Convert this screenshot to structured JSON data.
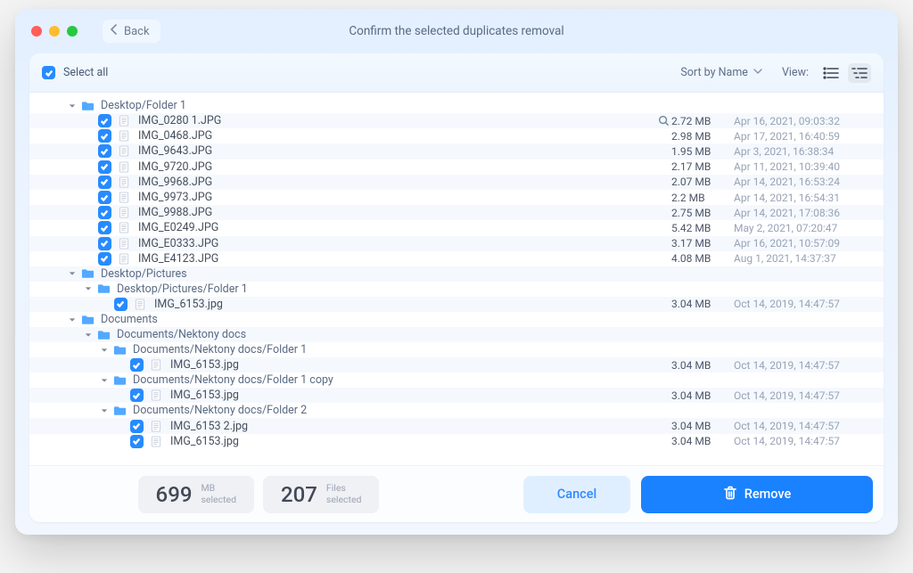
{
  "back": "Back",
  "title": "Confirm the selected duplicates removal",
  "select_all": "Select all",
  "sort_label": "Sort by Name",
  "view_label": "View:",
  "tree": [
    {
      "type": "folder",
      "depth": 0,
      "name": "Desktop/Folder 1"
    },
    {
      "type": "file",
      "depth": 1,
      "name": "IMG_0280 1.JPG",
      "size": "2.72 MB",
      "date": "Apr 16, 2021, 09:03:32",
      "mag": true,
      "stripe": true
    },
    {
      "type": "file",
      "depth": 1,
      "name": "IMG_0468.JPG",
      "size": "2.98 MB",
      "date": "Apr 17, 2021, 16:40:59"
    },
    {
      "type": "file",
      "depth": 1,
      "name": "IMG_9643.JPG",
      "size": "1.95 MB",
      "date": "Apr 3, 2021, 16:38:34",
      "stripe": true
    },
    {
      "type": "file",
      "depth": 1,
      "name": "IMG_9720.JPG",
      "size": "2.17 MB",
      "date": "Apr 11, 2021, 10:39:40"
    },
    {
      "type": "file",
      "depth": 1,
      "name": "IMG_9968.JPG",
      "size": "2.07 MB",
      "date": "Apr 14, 2021, 16:53:24",
      "stripe": true
    },
    {
      "type": "file",
      "depth": 1,
      "name": "IMG_9973.JPG",
      "size": "2.2 MB",
      "date": "Apr 14, 2021, 16:54:31"
    },
    {
      "type": "file",
      "depth": 1,
      "name": "IMG_9988.JPG",
      "size": "2.75 MB",
      "date": "Apr 14, 2021, 17:08:36",
      "stripe": true
    },
    {
      "type": "file",
      "depth": 1,
      "name": "IMG_E0249.JPG",
      "size": "5.42 MB",
      "date": "May 2, 2021, 07:20:47"
    },
    {
      "type": "file",
      "depth": 1,
      "name": "IMG_E0333.JPG",
      "size": "3.17 MB",
      "date": "Apr 16, 2021, 10:57:09",
      "stripe": true
    },
    {
      "type": "file",
      "depth": 1,
      "name": "IMG_E4123.JPG",
      "size": "4.08 MB",
      "date": "Aug 1, 2021, 14:37:37"
    },
    {
      "type": "folder",
      "depth": 0,
      "name": "Desktop/Pictures",
      "stripe": true
    },
    {
      "type": "folder",
      "depth": 1,
      "name": "Desktop/Pictures/Folder 1"
    },
    {
      "type": "file",
      "depth": 2,
      "name": "IMG_6153.jpg",
      "size": "3.04 MB",
      "date": "Oct 14, 2019, 14:47:57",
      "stripe": true
    },
    {
      "type": "folder",
      "depth": 0,
      "name": "Documents"
    },
    {
      "type": "folder",
      "depth": 1,
      "name": "Documents/Nektony docs",
      "stripe": true
    },
    {
      "type": "folder",
      "depth": 2,
      "name": "Documents/Nektony docs/Folder 1"
    },
    {
      "type": "file",
      "depth": 3,
      "name": "IMG_6153.jpg",
      "size": "3.04 MB",
      "date": "Oct 14, 2019, 14:47:57",
      "stripe": true
    },
    {
      "type": "folder",
      "depth": 2,
      "name": "Documents/Nektony docs/Folder 1 copy"
    },
    {
      "type": "file",
      "depth": 3,
      "name": "IMG_6153.jpg",
      "size": "3.04 MB",
      "date": "Oct 14, 2019, 14:47:57",
      "stripe": true
    },
    {
      "type": "folder",
      "depth": 2,
      "name": "Documents/Nektony docs/Folder 2"
    },
    {
      "type": "file",
      "depth": 3,
      "name": "IMG_6153 2.jpg",
      "size": "3.04 MB",
      "date": "Oct 14, 2019, 14:47:57",
      "stripe": true
    },
    {
      "type": "file",
      "depth": 3,
      "name": "IMG_6153.jpg",
      "size": "3.04 MB",
      "date": "Oct 14, 2019, 14:47:57"
    }
  ],
  "stats": {
    "mb_num": "699",
    "mb_unit": "MB",
    "mb_sub": "selected",
    "files_num": "207",
    "files_unit": "Files",
    "files_sub": "selected"
  },
  "cancel": "Cancel",
  "remove": "Remove"
}
